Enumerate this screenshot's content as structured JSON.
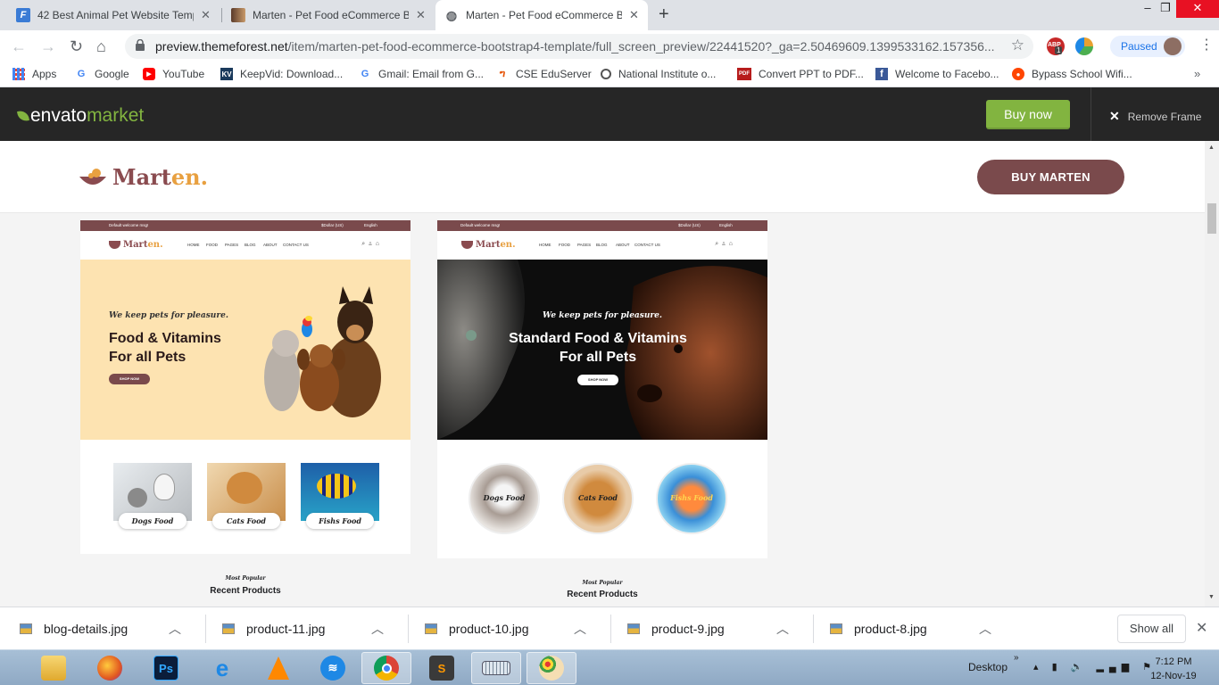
{
  "browser": {
    "tabs": [
      {
        "title": "42 Best Animal Pet Website Templ",
        "icon": "template-favicon",
        "active": false
      },
      {
        "title": "Marten - Pet Food eCommerce B",
        "icon": "marten-favicon",
        "active": false
      },
      {
        "title": "Marten - Pet Food eCommerce B",
        "icon": "globe-icon",
        "active": true
      }
    ],
    "url_domain": "preview.themeforest.net",
    "url_path": "/item/marten-pet-food-ecommerce-bootstrap4-template/full_screen_preview/22441520?_ga=2.50469609.1399533162.157356...",
    "profile_status": "Paused",
    "extension_badge": "1",
    "extension_label": "ABP"
  },
  "bookmarks": [
    {
      "label": "Apps",
      "icon": "apps-grid-icon"
    },
    {
      "label": "Google",
      "icon": "google-icon"
    },
    {
      "label": "YouTube",
      "icon": "youtube-icon"
    },
    {
      "label": "KeepVid: Download...",
      "icon": "keepvid-icon"
    },
    {
      "label": "Gmail: Email from G...",
      "icon": "google-icon"
    },
    {
      "label": "CSE EduServer",
      "icon": "eduserver-icon"
    },
    {
      "label": "National Institute o...",
      "icon": "institute-icon"
    },
    {
      "label": "Convert PPT to PDF...",
      "icon": "pdf-icon"
    },
    {
      "label": "Welcome to Facebo...",
      "icon": "facebook-icon"
    },
    {
      "label": "Bypass School Wifi...",
      "icon": "reddit-icon"
    }
  ],
  "envato": {
    "logo_word1": "envato",
    "logo_word2": "market",
    "buy_now": "Buy now",
    "remove_frame": "Remove Frame"
  },
  "site": {
    "logo_main": "Mart",
    "logo_accent": "en.",
    "buy_button": "BUY MARTEN"
  },
  "previews": [
    {
      "topbar_left": "Default welcome msg!",
      "topbar_currency": "$Dollar (US)",
      "topbar_lang": "English",
      "logo_main": "Mart",
      "logo_accent": "en.",
      "menu": [
        "HOME",
        "FOOD",
        "PAGES",
        "BLOG",
        "ABOUT",
        "CONTACT US"
      ],
      "hero_tagline": "We keep pets for pleasure.",
      "hero_title_1": "Food & Vitamins",
      "hero_title_2": "For all Pets",
      "hero_button": "SHOP NOW",
      "categories": [
        "Dogs Food",
        "Cats Food",
        "Fishs Food"
      ],
      "popular_small": "Most Popular",
      "popular_big": "Recent Products"
    },
    {
      "topbar_left": "Default welcome msg!",
      "topbar_currency": "$Dollar (US)",
      "topbar_lang": "English",
      "logo_main": "Mart",
      "logo_accent": "en.",
      "menu": [
        "HOME",
        "FOOD",
        "PAGES",
        "BLOG",
        "ABOUT",
        "CONTACT US"
      ],
      "hero_tagline": "We keep pets for pleasure.",
      "hero_title_1": "Standard Food & Vitamins",
      "hero_title_2": "For all Pets",
      "hero_button": "SHOP NOW",
      "categories": [
        "Dogs Food",
        "Cats Food",
        "Fishs Food"
      ],
      "popular_small": "Most Popular",
      "popular_big": "Recent Products"
    }
  ],
  "downloads": {
    "items": [
      "blog-details.jpg",
      "product-11.jpg",
      "product-10.jpg",
      "product-9.jpg",
      "product-8.jpg"
    ],
    "show_all": "Show all"
  },
  "taskbar": {
    "apps": [
      "file-explorer-icon",
      "firefox-icon",
      "photoshop-icon",
      "internet-explorer-icon",
      "vlc-icon",
      "wifi-hotspot-icon",
      "chrome-icon",
      "sublime-text-icon",
      "keyboard-icon",
      "paint-icon"
    ],
    "photoshop_label": "Ps",
    "desktop_label": "Desktop",
    "time": "7:12 PM",
    "date": "12-Nov-19"
  },
  "colors": {
    "envato_bar": "#262626",
    "envato_green": "#82b440",
    "marten_brown": "#7a4a4c",
    "marten_accent": "#e8a040",
    "hero_peach": "#fde3b1"
  }
}
